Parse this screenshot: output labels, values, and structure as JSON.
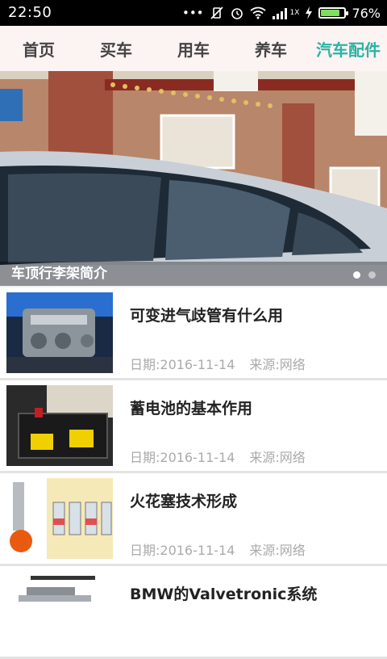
{
  "status_bar": {
    "time": "22:50",
    "network_label": "1X",
    "battery_percent": "76%",
    "battery_level": 0.76
  },
  "tabs": [
    {
      "label": "首页",
      "active": false
    },
    {
      "label": "买车",
      "active": false
    },
    {
      "label": "用车",
      "active": false
    },
    {
      "label": "养车",
      "active": false
    },
    {
      "label": "汽车配件",
      "active": true
    }
  ],
  "banner": {
    "title": "车顶行李架简介",
    "page_count": 2,
    "current_page": 1
  },
  "news": [
    {
      "title": "可变进气歧管有什么用",
      "date": "日期:2016-11-14",
      "source": "来源:网络",
      "thumb": "engine-image"
    },
    {
      "title": "蓄电池的基本作用",
      "date": "日期:2016-11-14",
      "source": "来源:网络",
      "thumb": "battery-image"
    },
    {
      "title": "火花塞技术形成",
      "date": "日期:2016-11-14",
      "source": "来源:网络",
      "thumb": "spark-plug-image"
    },
    {
      "title": "BMW的Valvetronic系统",
      "date": "",
      "source": "",
      "thumb": "valvetronic-image"
    }
  ],
  "colors": {
    "active_tab": "#2bb3a3",
    "tab_bar_bg": "#fcf3f3",
    "meta_text": "#aaaaaa"
  }
}
